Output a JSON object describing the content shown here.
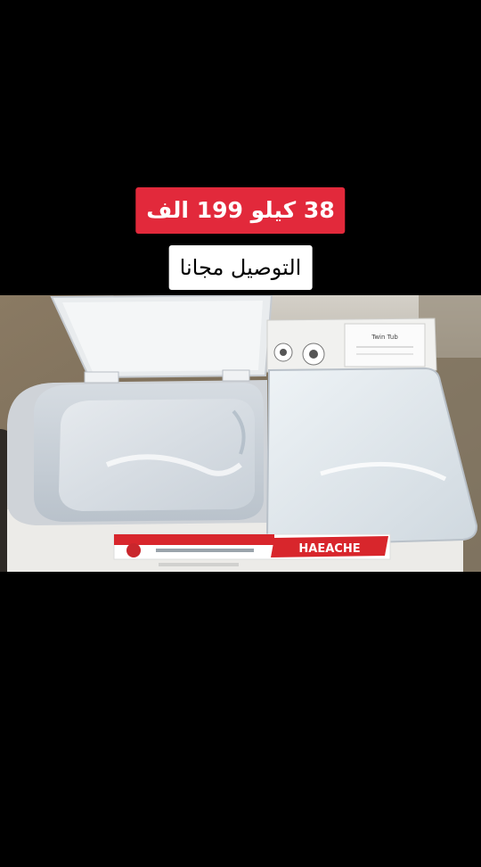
{
  "captions": {
    "price": "38 كيلو 199 الف",
    "delivery": "التوصيل مجانا"
  },
  "product_label": {
    "brand": "HAEACHE",
    "panel_text": "Twin Tub"
  },
  "colors": {
    "background": "#000000",
    "price_caption_bg": "#e2293b",
    "price_caption_text": "#ffffff",
    "delivery_caption_bg": "#ffffff",
    "delivery_caption_text": "#000000",
    "brand_red": "#d8262c"
  }
}
